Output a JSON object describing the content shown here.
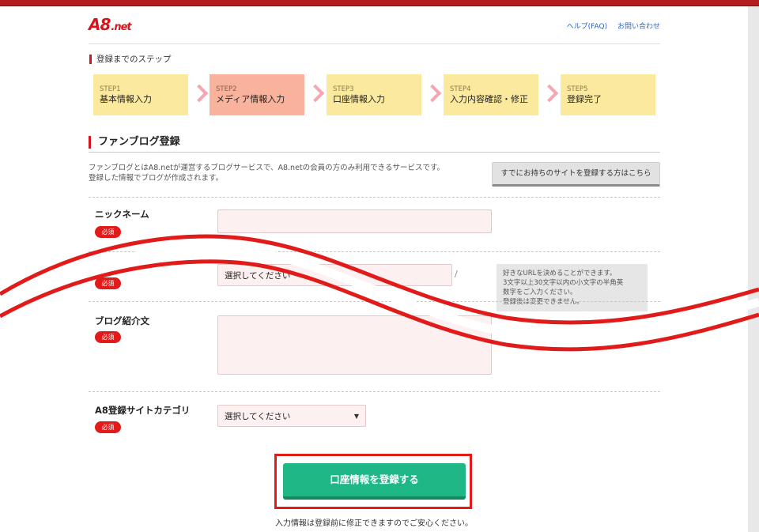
{
  "header": {
    "logo_text": "A8",
    "logo_suffix": ".net",
    "links": [
      "ヘルプ(FAQ)",
      "お問い合わせ"
    ]
  },
  "steps_title": "登録までのステップ",
  "steps": [
    {
      "num": "STEP1",
      "label": "基本情報入力",
      "active": false
    },
    {
      "num": "STEP2",
      "label": "メディア情報入力",
      "active": true
    },
    {
      "num": "STEP3",
      "label": "口座情報入力",
      "active": false
    },
    {
      "num": "STEP4",
      "label": "入力内容確認・修正",
      "active": false
    },
    {
      "num": "STEP5",
      "label": "登録完了",
      "active": false
    }
  ],
  "section": {
    "title": "ファンブログ登録",
    "intro_line1": "ファンブログとはA8.netが運営するブログサービスで、A8.netの会員の方のみ利用できるサービスです。",
    "intro_line2": "登録した情報でブログが作成されます。",
    "existing_site_button": "すでにお持ちのサイトを登録する方はこちら"
  },
  "form": {
    "required_label": "必須",
    "nickname": {
      "label": "ニックネーム",
      "value": ""
    },
    "blog_url": {
      "label": "",
      "value": "選択してください",
      "separator": "/",
      "hint_lines": [
        "好きなURLを決めることができます。",
        "3文字以上30文字以内の小文字の半角英",
        "数字をご入力ください。",
        "登録後は変更できません。"
      ]
    },
    "blog_intro": {
      "label": "ブログ紹介文",
      "value": ""
    },
    "category": {
      "label": "A8登録サイトカテゴリ",
      "value": "選択してください"
    }
  },
  "submit": {
    "label": "口座情報を登録する",
    "note": "入力情報は登録前に修正できますのでご安心ください。"
  },
  "colors": {
    "brand_red": "#d7141a",
    "submit_green": "#1fb786",
    "step_yellow": "#fbe99e",
    "step_active": "#f9b29b"
  }
}
